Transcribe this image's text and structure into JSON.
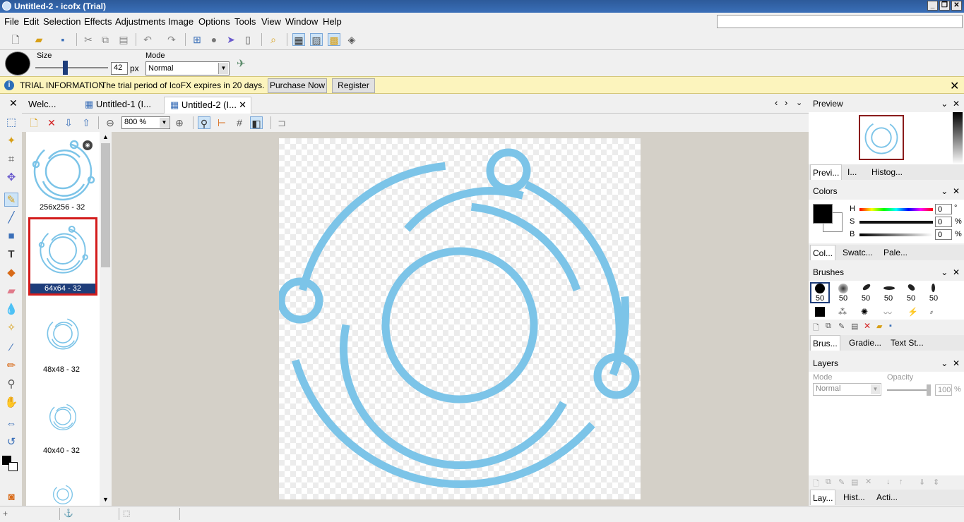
{
  "window": {
    "title": "Untitled-2 - icofx (Trial)"
  },
  "menu": [
    "File",
    "Edit",
    "Selection",
    "Effects",
    "Adjustments",
    "Image",
    "Options",
    "Tools",
    "View",
    "Window",
    "Help"
  ],
  "options_bar": {
    "size_label": "Size",
    "size_value": "42",
    "size_unit": "px",
    "mode_label": "Mode",
    "mode_value": "Normal",
    "size_slider_fraction": 0.38
  },
  "trial": {
    "label": "TRIAL INFORMATION",
    "message": "The trial period of IcoFX expires in 20 days.",
    "purchase": "Purchase Now",
    "register": "Register"
  },
  "tabs": [
    "Welc...",
    "Untitled-1 (I...",
    "Untitled-2 (I..."
  ],
  "zoom": "800 %",
  "thumbnails": [
    "256x256 - 32",
    "64x64 - 32",
    "48x48 - 32",
    "40x40 - 32"
  ],
  "preview": {
    "title": "Preview",
    "tabs": [
      "Previ...",
      "I...",
      "Histog..."
    ]
  },
  "colors": {
    "title": "Colors",
    "h_label": "H",
    "s_label": "S",
    "b_label": "B",
    "h_value": "0",
    "s_value": "0",
    "b_value": "0",
    "h_unit": "°",
    "s_unit": "%",
    "b_unit": "%",
    "tabs": [
      "Col...",
      "Swatc...",
      "Pale..."
    ],
    "primary": "#000000",
    "secondary": "#ffffff"
  },
  "brushes": {
    "title": "Brushes",
    "sizes": [
      "50",
      "50",
      "50",
      "50",
      "50",
      "50"
    ],
    "tabs": [
      "Brus...",
      "Gradie...",
      "Text St..."
    ]
  },
  "layers": {
    "title": "Layers",
    "mode_label": "Mode",
    "mode_value": "Normal",
    "opacity_label": "Opacity",
    "opacity_value": "100",
    "opacity_unit": "%",
    "tabs": [
      "Lay...",
      "Hist...",
      "Acti..."
    ]
  },
  "icons": {
    "titlebar": "app-icon",
    "info": "info-icon"
  },
  "accent": "#7cc4e8"
}
